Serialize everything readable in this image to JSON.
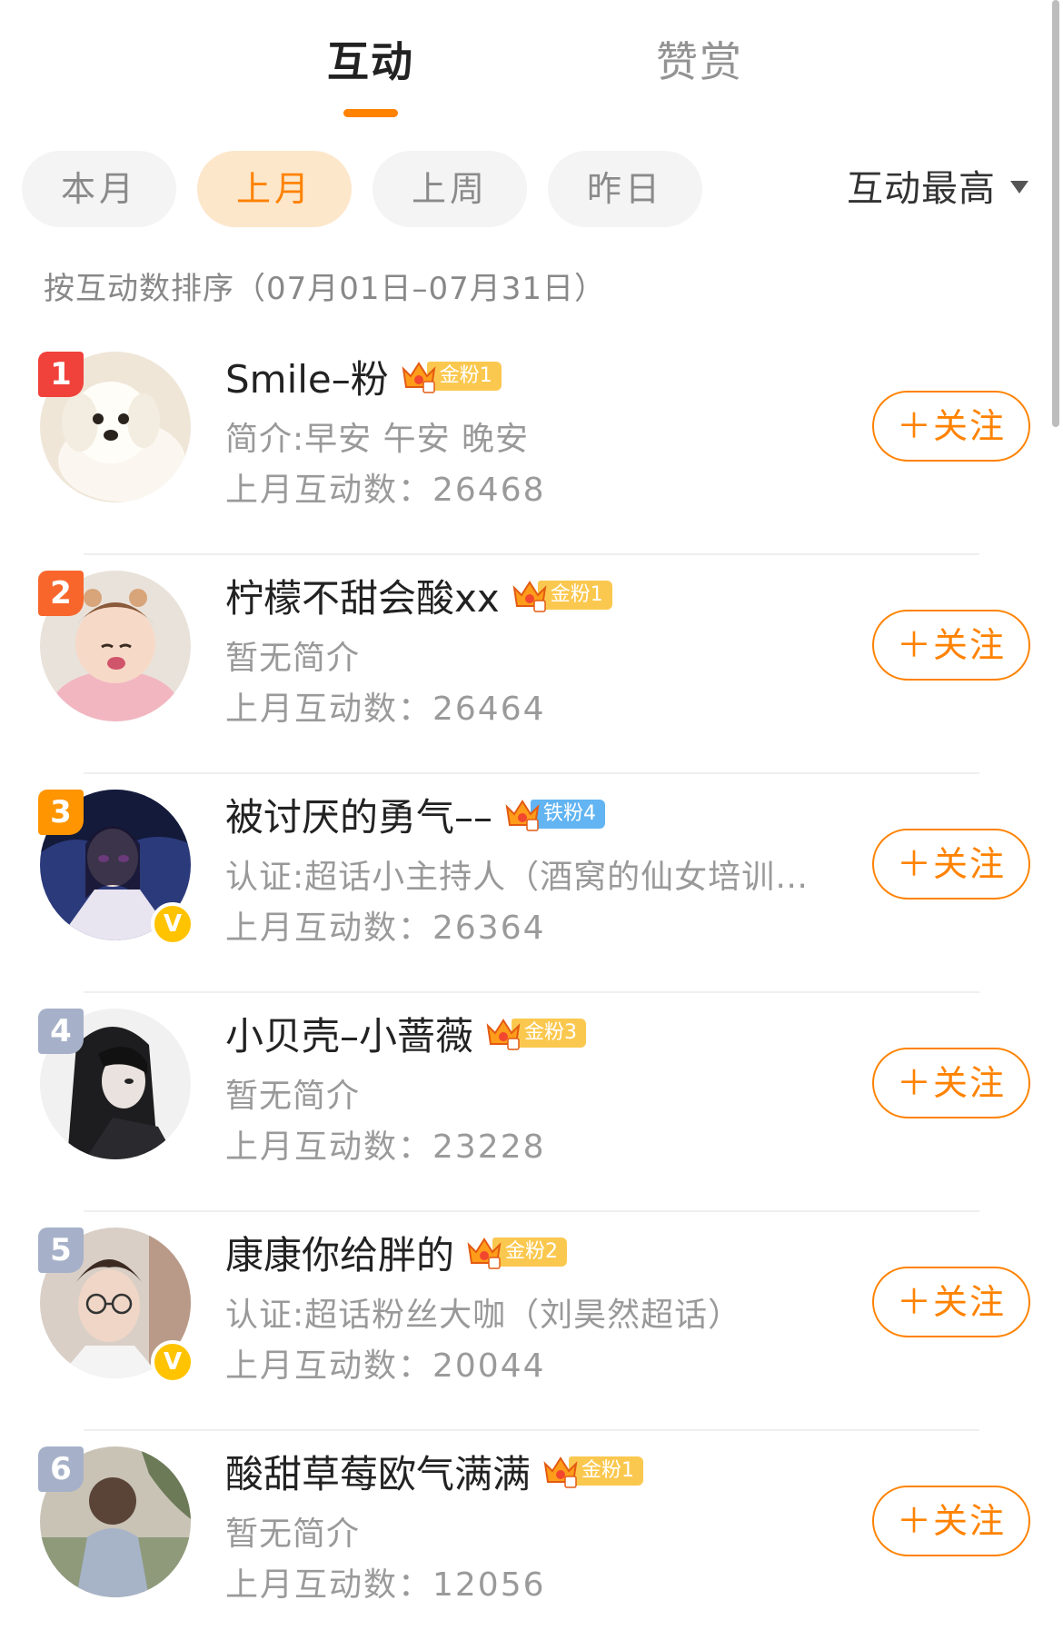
{
  "tabs": {
    "interaction": "互动",
    "reward": "赞赏"
  },
  "filters": {
    "this_month": "本月",
    "last_month": "上月",
    "last_week": "上周",
    "yesterday": "昨日",
    "active": "last_month"
  },
  "sort": {
    "label": "互动最高"
  },
  "sort_note": "按互动数排序（07月01日–07月31日）",
  "colors": {
    "accent": "#ff8200",
    "rank_1": "#f0413a",
    "rank_2": "#f8662c",
    "rank_3": "#ff9500",
    "rank_other": "#a6b1c9",
    "gold_fan": "#fbc84f",
    "iron_fan": "#62b4f2",
    "verify": "#ffc300"
  },
  "follow_label": "＋关注",
  "users": [
    {
      "rank": "1",
      "name": "Smile–粉",
      "fan_level": "金粉1",
      "bio": "简介:早安 午安 晚安",
      "count": "上月互动数：26468"
    },
    {
      "rank": "2",
      "name": "柠檬不甜会酸xx",
      "fan_level": "金粉1",
      "bio": "暂无简介",
      "count": "上月互动数：26464"
    },
    {
      "rank": "3",
      "name": "被讨厌的勇气––",
      "fan_level": "铁粉4",
      "bio": "认证:超话小主持人（酒窝的仙女培训班...",
      "count": "上月互动数：26364"
    },
    {
      "rank": "4",
      "name": "小贝壳–小蔷薇",
      "fan_level": "金粉3",
      "bio": "暂无简介",
      "count": "上月互动数：23228"
    },
    {
      "rank": "5",
      "name": "康康你给胖的",
      "fan_level": "金粉2",
      "bio": "认证:超话粉丝大咖（刘昊然超话）",
      "count": "上月互动数：20044"
    },
    {
      "rank": "6",
      "name": "酸甜草莓欧气满满",
      "fan_level": "金粉1",
      "bio": "暂无简介",
      "count": "上月互动数：12056"
    }
  ],
  "verified_badge": "V"
}
